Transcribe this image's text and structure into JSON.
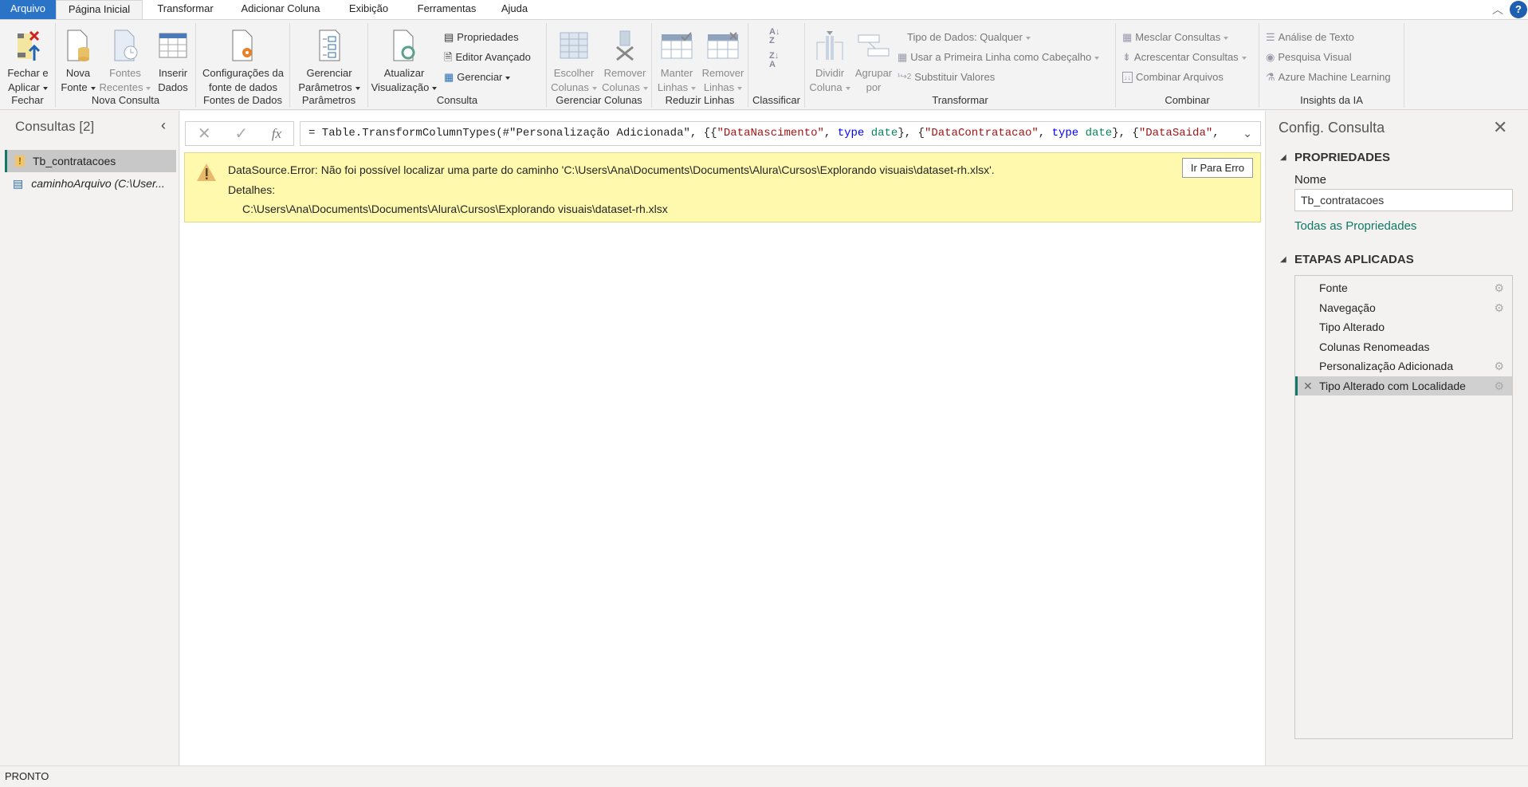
{
  "tabs": [
    "Arquivo",
    "Página Inicial",
    "Transformar",
    "Adicionar Coluna",
    "Exibição",
    "Ferramentas",
    "Ajuda"
  ],
  "active_tab": "Página Inicial",
  "ribbon": {
    "groups": {
      "fechar": "Fechar",
      "nova_consulta": "Nova Consulta",
      "fontes_dados": "Fontes de Dados",
      "parametros": "Parâmetros",
      "consulta": "Consulta",
      "gerenciar_colunas": "Gerenciar Colunas",
      "reduzir_linhas": "Reduzir Linhas",
      "classificar": "Classificar",
      "transformar": "Transformar",
      "combinar": "Combinar",
      "insights": "Insights da IA"
    },
    "fechar_aplicar": [
      "Fechar e",
      "Aplicar"
    ],
    "nova_fonte": [
      "Nova",
      "Fonte"
    ],
    "fontes_recentes": [
      "Fontes",
      "Recentes"
    ],
    "inserir_dados": [
      "Inserir",
      "Dados"
    ],
    "config_fonte": [
      "Configurações da",
      "fonte de dados"
    ],
    "gerenciar_parametros": [
      "Gerenciar",
      "Parâmetros"
    ],
    "atualizar": [
      "Atualizar",
      "Visualização"
    ],
    "propriedades": "Propriedades",
    "editor_avancado": "Editor Avançado",
    "gerenciar": "Gerenciar",
    "escolher_colunas": [
      "Escolher",
      "Colunas"
    ],
    "remover_colunas": [
      "Remover",
      "Colunas"
    ],
    "manter_linhas": [
      "Manter",
      "Linhas"
    ],
    "remover_linhas": [
      "Remover",
      "Linhas"
    ],
    "dividir_coluna": [
      "Dividir",
      "Coluna"
    ],
    "agrupar_por": [
      "Agrupar",
      "por"
    ],
    "tipo_dados": "Tipo de Dados: Qualquer",
    "primeira_linha": "Usar a Primeira Linha como Cabeçalho",
    "substituir": "Substituir Valores",
    "mesclar": "Mesclar Consultas",
    "acrescentar": "Acrescentar Consultas",
    "combinar_arquivos": "Combinar Arquivos",
    "analise_texto": "Análise de Texto",
    "pesquisa_visual": "Pesquisa Visual",
    "azure_ml": "Azure Machine Learning"
  },
  "queries": {
    "title": "Consultas [2]",
    "items": [
      {
        "name": "Tb_contratacoes",
        "icon": "warning-icon"
      },
      {
        "name": "caminhoArquivo (C:\\User...",
        "icon": "parameter-icon"
      }
    ]
  },
  "formula": {
    "fx": "fx",
    "prefix": "= Table.TransformColumnTypes(#\"Personalização Adicionada\", {{",
    "s1": "\"DataNascimento\"",
    "c1": ", ",
    "kw1": "type",
    "t1": " date",
    "e1": "}, {",
    "s2": "\"DataContratacao\"",
    "c2": ", ",
    "kw2": "type",
    "t2": " date",
    "e2": "}, {",
    "s3": "\"DataSaida\"",
    "c3": ","
  },
  "error": {
    "message": "DataSource.Error: Não foi possível localizar uma parte do caminho 'C:\\Users\\Ana\\Documents\\Documents\\Alura\\Cursos\\Explorando visuais\\dataset-rh.xlsx'.",
    "details_label": "Detalhes:",
    "details": "C:\\Users\\Ana\\Documents\\Documents\\Alura\\Cursos\\Explorando visuais\\dataset-rh.xlsx",
    "button": "Ir Para Erro"
  },
  "settings": {
    "title": "Config. Consulta",
    "properties": "PROPRIEDADES",
    "name_label": "Nome",
    "name_value": "Tb_contratacoes",
    "all_props": "Todas as Propriedades",
    "steps_title": "ETAPAS APLICADAS",
    "steps": [
      {
        "label": "Fonte",
        "gear": true
      },
      {
        "label": "Navegação",
        "gear": true
      },
      {
        "label": "Tipo Alterado",
        "gear": false
      },
      {
        "label": "Colunas Renomeadas",
        "gear": false
      },
      {
        "label": "Personalização Adicionada",
        "gear": true
      },
      {
        "label": "Tipo Alterado com Localidade",
        "gear": true,
        "selected": true
      }
    ]
  },
  "status": "PRONTO",
  "colors": {
    "accent": "#117865",
    "file_tab": "#2b73c6",
    "error_bg": "#fff9ae",
    "string": "#a31515",
    "keyword": "#0000ff",
    "type": "#098658"
  }
}
